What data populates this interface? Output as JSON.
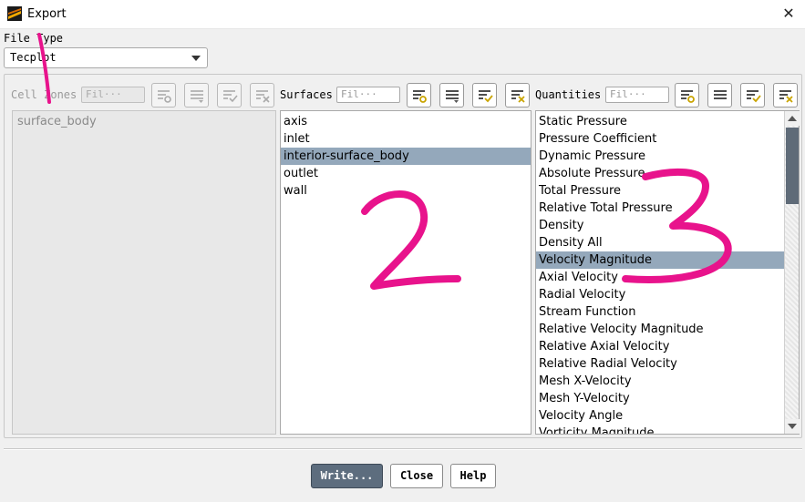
{
  "window": {
    "title": "Export",
    "close_glyph": "✕",
    "icon": "app-logo-icon"
  },
  "file_type": {
    "label": "File Type",
    "selected": "Tecplot"
  },
  "cell_zones": {
    "label": "Cell Zones",
    "filter_placeholder": "Fil···",
    "items": [
      "surface_body"
    ]
  },
  "surfaces": {
    "label": "Surfaces",
    "filter_placeholder": "Fil···",
    "items": [
      "axis",
      "inlet",
      "interior-surface_body",
      "outlet",
      "wall"
    ],
    "selected_index": 2
  },
  "quantities": {
    "label": "Quantities",
    "filter_placeholder": "Fil···",
    "items": [
      "Static Pressure",
      "Pressure Coefficient",
      "Dynamic Pressure",
      "Absolute Pressure",
      "Total Pressure",
      "Relative Total Pressure",
      "Density",
      "Density All",
      "Velocity Magnitude",
      "Axial Velocity",
      "Radial Velocity",
      "Stream Function",
      "Relative Velocity Magnitude",
      "Relative Axial Velocity",
      "Relative Radial Velocity",
      "Mesh X-Velocity",
      "Mesh Y-Velocity",
      "Velocity Angle",
      "Vorticity Magnitude"
    ],
    "selected_index": 8
  },
  "buttons": {
    "write": "Write...",
    "close": "Close",
    "help": "Help"
  },
  "annotations": {
    "one": "1",
    "two": "2",
    "three": "3",
    "color": "#e8138c"
  },
  "colors": {
    "selection": "#94a8bb",
    "primary_button": "#5d6d7e",
    "tool_check": "#c9a400"
  }
}
